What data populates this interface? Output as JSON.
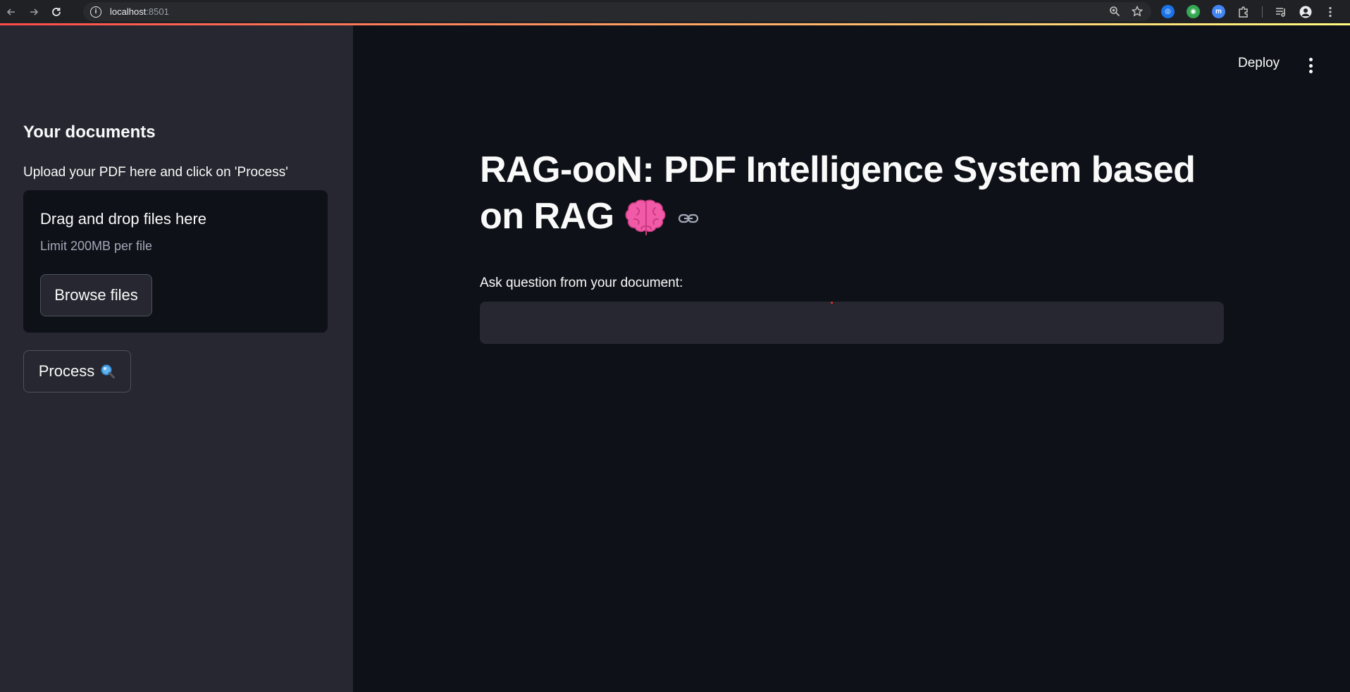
{
  "browser": {
    "url_host": "localhost",
    "url_port": ":8501",
    "extensions": [
      {
        "name": "extension-blue",
        "color": "#1a73e8",
        "glyph": "◎"
      },
      {
        "name": "extension-green",
        "color": "#34a853",
        "glyph": "◉"
      },
      {
        "name": "extension-indigo",
        "color": "#4285f4",
        "glyph": "m"
      }
    ]
  },
  "sidebar": {
    "title": "Your documents",
    "caption": "Upload your PDF here and click on 'Process'",
    "uploader": {
      "title": "Drag and drop files here",
      "limit": "Limit 200MB per file",
      "browse_label": "Browse files"
    },
    "process_label": "Process"
  },
  "header": {
    "deploy_label": "Deploy"
  },
  "main": {
    "title": "RAG-ooN: PDF Intelligence System based on RAG",
    "question_label": "Ask question from your document:",
    "question_value": "",
    "question_placeholder": ""
  },
  "colors": {
    "accent": "#ff4b4b",
    "sidebar_bg": "#262730",
    "main_bg": "#0e1117"
  }
}
